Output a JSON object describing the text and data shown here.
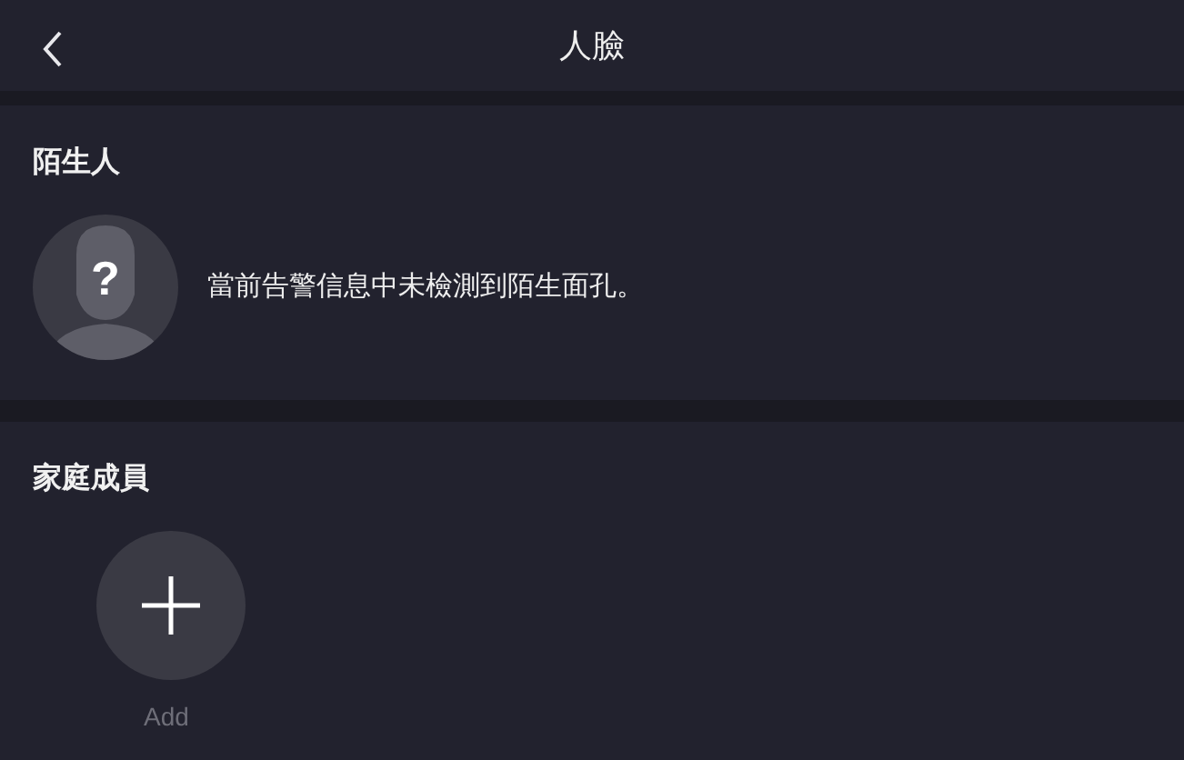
{
  "header": {
    "title": "人臉"
  },
  "stranger": {
    "heading": "陌生人",
    "avatar_glyph": "?",
    "message": "當前告警信息中未檢測到陌生面孔。"
  },
  "family": {
    "heading": "家庭成員",
    "add_label": "Add"
  }
}
